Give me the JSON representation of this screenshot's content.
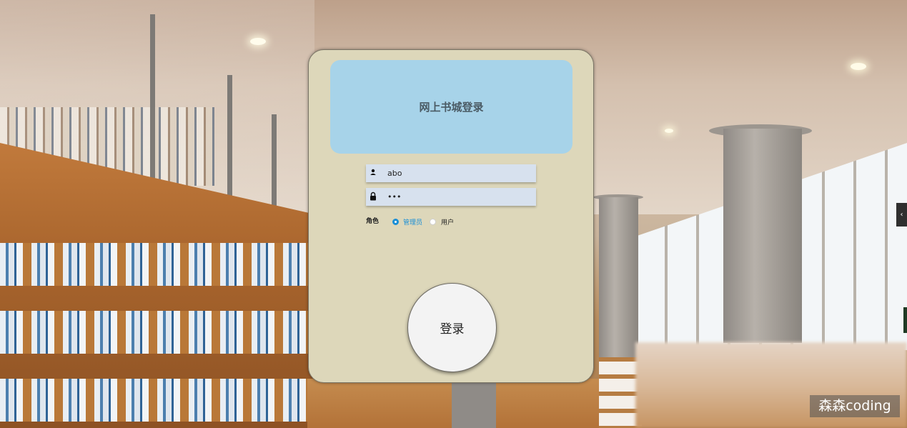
{
  "header": {
    "title": "网上书城登录"
  },
  "form": {
    "username": {
      "value": "abo",
      "icon": "user-icon"
    },
    "password": {
      "value": "•••",
      "icon": "lock-icon"
    },
    "role": {
      "label": "角色",
      "options": [
        {
          "label": "管理员",
          "checked": true
        },
        {
          "label": "用户",
          "checked": false
        }
      ]
    },
    "login_button": "登录"
  },
  "sidebar_toggle": "‹",
  "watermark": "森森coding",
  "colors": {
    "panel_bg": "#ddd7ba",
    "header_bg": "#a7d3e9",
    "input_bg": "#d7e1ee",
    "accent": "#1a8fd6"
  }
}
